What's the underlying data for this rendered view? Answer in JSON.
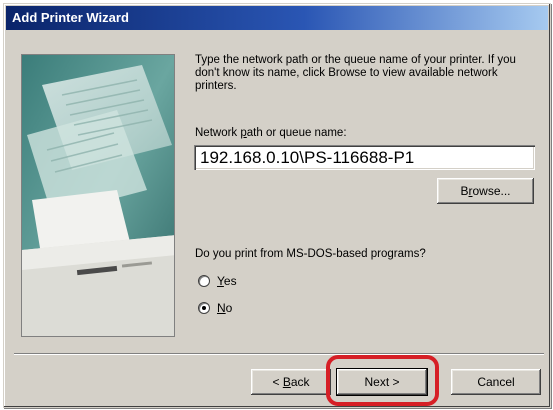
{
  "window": {
    "title": "Add Printer Wizard"
  },
  "instructions": "Type the network path or the queue name of your printer. If you don't know its name, click Browse to view available network printers.",
  "path_field": {
    "label_pre": "Network ",
    "label_accel": "p",
    "label_post": "ath or queue name:",
    "value": "192.168.0.10\\PS-116688-P1"
  },
  "browse_button": {
    "accel": "r",
    "pre": "B",
    "post": "owse..."
  },
  "msdos_question": {
    "text": "Do you print from MS-DOS-based programs?",
    "options": [
      {
        "accel": "Y",
        "rest": "es",
        "checked": false
      },
      {
        "accel": "N",
        "rest": "o",
        "checked": true
      }
    ]
  },
  "footer": {
    "back": {
      "pre": "< ",
      "accel": "B",
      "post": "ack"
    },
    "next_label": "Next >",
    "cancel_label": "Cancel"
  },
  "colors": {
    "titlebar_start": "#0a246a",
    "face": "#d4d0c8",
    "highlight_ring": "#d61f26"
  }
}
